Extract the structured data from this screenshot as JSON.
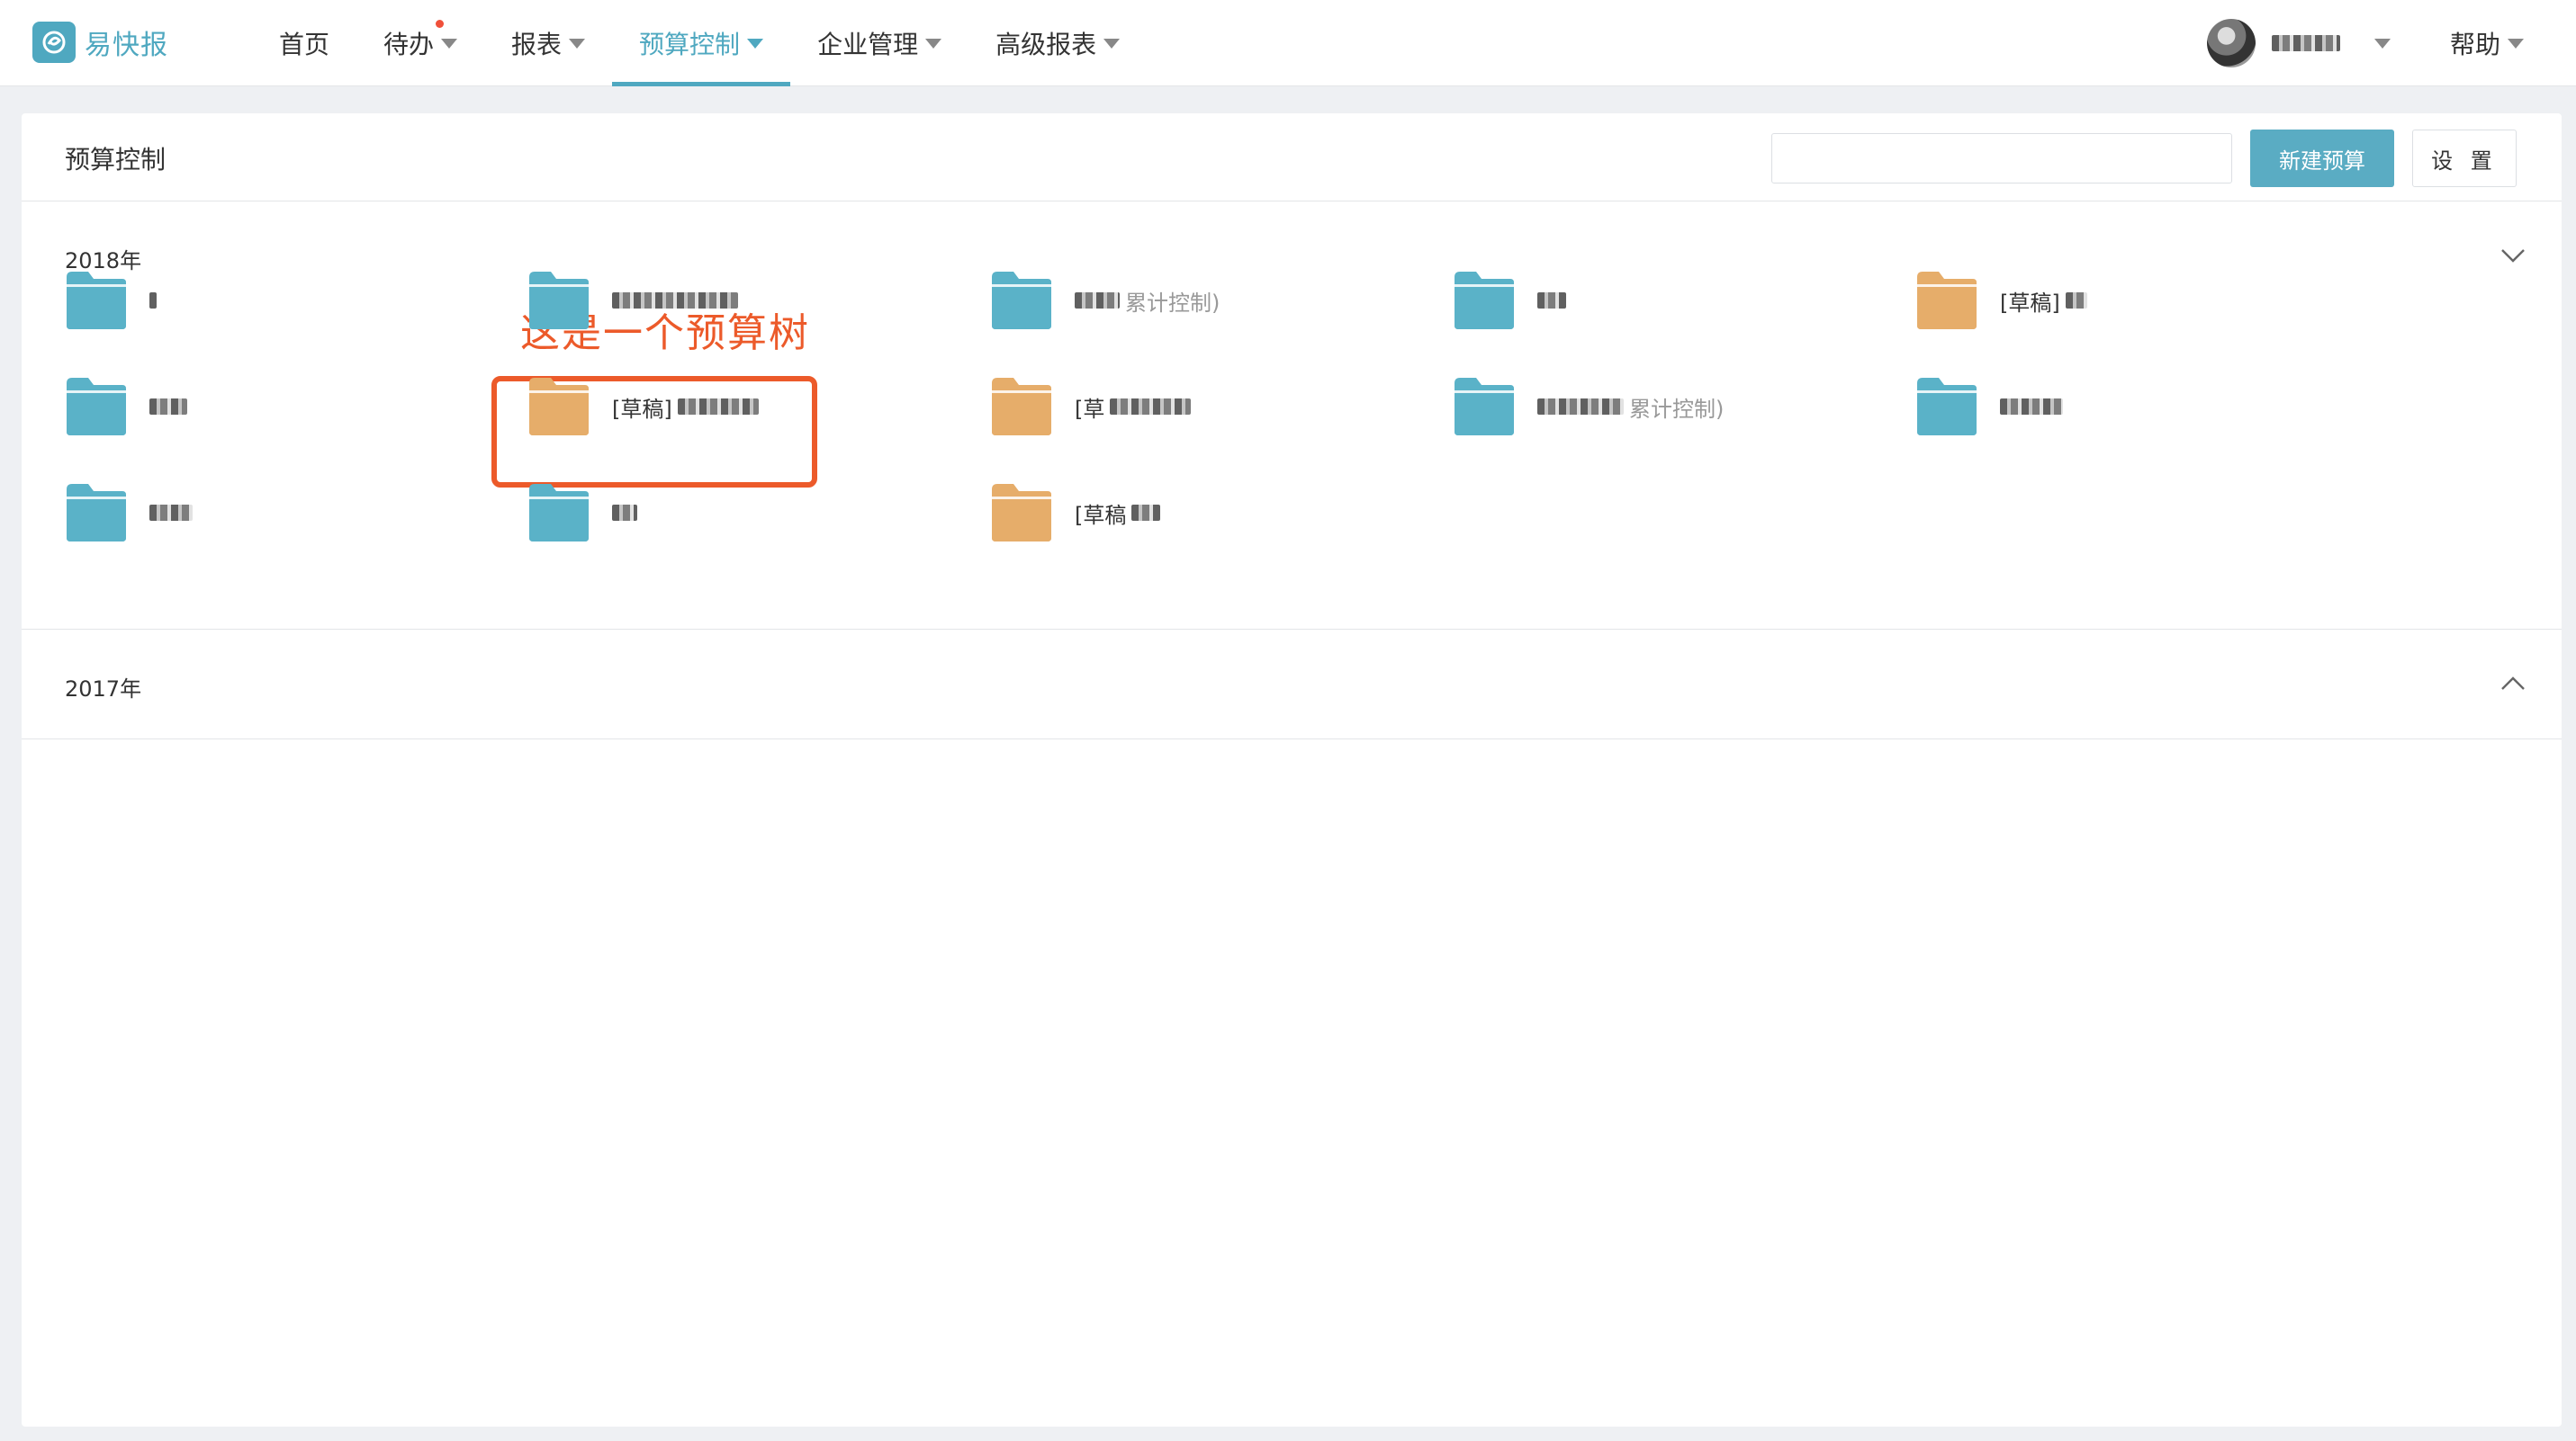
{
  "brand": {
    "name": "易快报"
  },
  "nav": [
    {
      "label": "首页"
    },
    {
      "label": "待办"
    },
    {
      "label": "报表"
    },
    {
      "label": "预算控制"
    },
    {
      "label": "企业管理"
    },
    {
      "label": "高级报表"
    }
  ],
  "header": {
    "help_label": "帮助"
  },
  "panel": {
    "title": "预算控制",
    "search_placeholder": "",
    "new_budget_label": "新建预算",
    "settings_label": "设 置"
  },
  "annotation": "这是一个预算树",
  "sections": [
    {
      "year": "2018年",
      "expanded": true,
      "folders": [
        {
          "status": "normal",
          "prefix": "",
          "suffix": ""
        },
        {
          "status": "normal",
          "prefix": "",
          "suffix": ""
        },
        {
          "status": "normal",
          "prefix": "",
          "suffix": "累计控制)"
        },
        {
          "status": "normal",
          "prefix": "",
          "suffix": ""
        },
        {
          "status": "draft",
          "prefix": "[草稿]",
          "suffix": ""
        },
        {
          "status": "normal",
          "prefix": "",
          "suffix": ""
        },
        {
          "status": "draft",
          "prefix": "[草稿]",
          "suffix": ""
        },
        {
          "status": "draft",
          "prefix": "[草",
          "suffix": ""
        },
        {
          "status": "normal",
          "prefix": "",
          "suffix": "累计控制)"
        },
        {
          "status": "normal",
          "prefix": "",
          "suffix": ""
        },
        {
          "status": "normal",
          "prefix": "",
          "suffix": ""
        },
        {
          "status": "normal",
          "prefix": "",
          "suffix": ""
        },
        {
          "status": "draft",
          "prefix": "[草稿",
          "suffix": ""
        }
      ]
    },
    {
      "year": "2017年",
      "expanded": false
    }
  ],
  "colors": {
    "accent": "#4fa8c0",
    "folder_normal": "#5ab2c8",
    "folder_draft": "#e6ad6a",
    "annotation": "#ec5a2a"
  }
}
